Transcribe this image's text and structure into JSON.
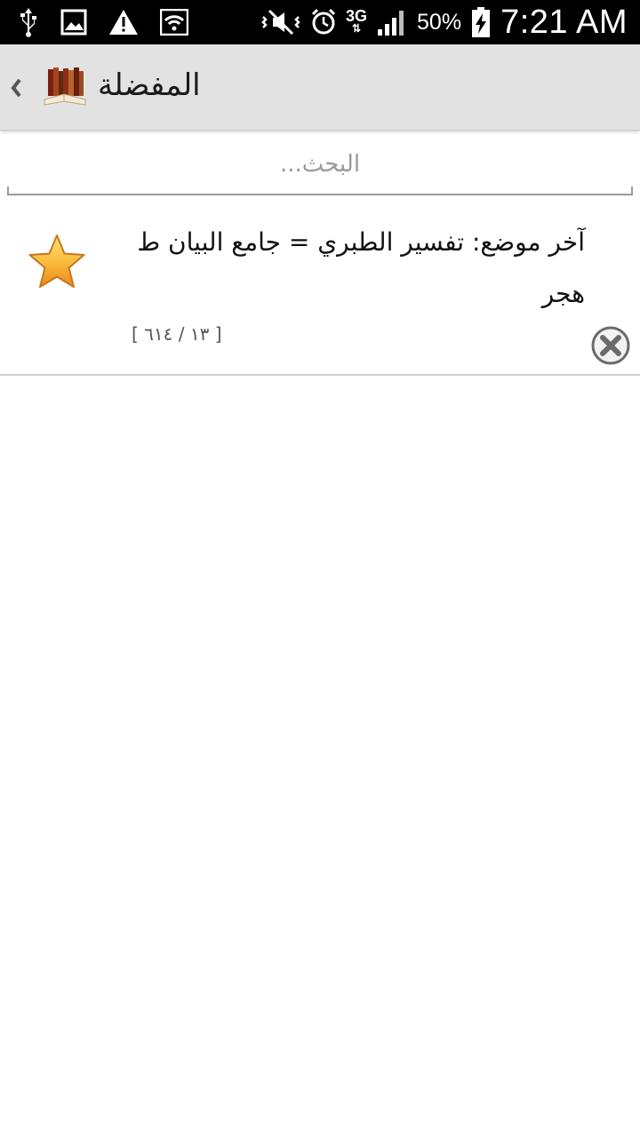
{
  "status_bar": {
    "battery_percent": "50%",
    "time": "7:21 AM",
    "network": "3G",
    "icons": [
      "usb-icon",
      "image-icon",
      "warning-icon",
      "wifi-icon",
      "mute-icon",
      "alarm-icon",
      "network-3g-icon",
      "signal-icon",
      "battery-charging-icon"
    ]
  },
  "action_bar": {
    "title": "المفضلة",
    "icons": [
      "up-chevron-icon",
      "books-app-icon"
    ]
  },
  "search": {
    "placeholder": "البحث..."
  },
  "favorites": [
    {
      "title": "آخر موضع: تفسير الطبري = جامع البيان ط هجر",
      "location": "[ ١٣ / ٦١٤ ]",
      "icon": "star-icon"
    }
  ],
  "colors": {
    "status_bar_bg": "#000000",
    "action_bar_bg": "#e2e2e2",
    "star": "#f5a623",
    "delete": "#6b6b6b"
  }
}
